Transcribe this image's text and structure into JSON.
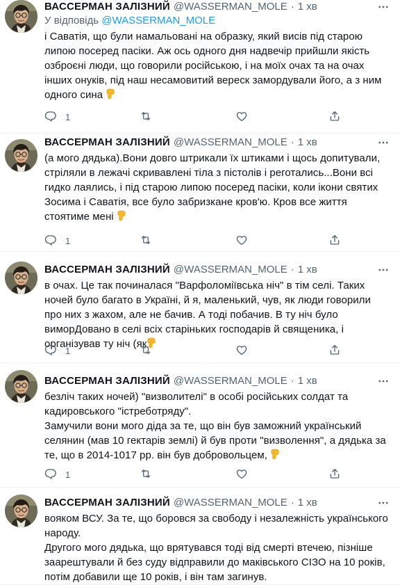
{
  "author": {
    "name": "ВАССЕРМАН ЗАЛІЗНИЙ",
    "handle": "@WASSERMAN_MOLE",
    "separator": "·",
    "time": "1 хв"
  },
  "reply_to": {
    "prefix": "У відповідь",
    "mention": "@WASSERMAN_MOLE"
  },
  "icons": {
    "reply": "reply-icon",
    "retweet": "retweet-icon",
    "like": "heart-icon",
    "share": "share-icon",
    "more": "more-icon",
    "finger": "backhand-index-pointing-down-emoji"
  },
  "colors": {
    "accent": "#1d9bf0",
    "muted": "#536471",
    "emoji": "#f4b400"
  },
  "tweets": [
    {
      "text": "і Саватія, що були намальовані на образку, який висів під старою липою посеред пасіки. Аж ось одного дня надвечір прийшли якість озброєні люди, що говорили російською, і на моїх очах та на очах інших онуків, під наш несамовитий вереск замордували його, а з ним одного сина ",
      "reply_count": "1"
    },
    {
      "text": "(а мого дядька).Вони довго штрикали їх штиками і щось допитували, стріляли в лежачі скривавлені тіла з пістолів і реготались...Вони всі гидко лаялись, і під старою липою посеред пасіки, коли ікони святих Зосима і Саватія, все було забризкане кров'ю. Кров все життя стоятиме мені ",
      "reply_count": "1"
    },
    {
      "text": "в очах. Це так починалася \"Варфоломіївська ніч\" в тім селі. Таких ночей було багато в Україні, й я, маленький, чув, як люди говорили про них з жахом, але не бачив. А тоді побачив. В ту ніч було виморДовано в селі всіх старіньких господарів й священика, і організував ту ніч (як",
      "reply_count": "1"
    },
    {
      "text": "безліч таких ночей) \"визволителі\" в особі російських солдат та кадировського \"істреботряду\".\nЗамучили вони мого діда за те, що він був заможний український селянин (мав 10 гектарів  землі) й був проти \"визволення\", а дядька за те, що    в 2014-1017 рр. він був добровольцем, ",
      "reply_count": "1"
    },
    {
      "text": "вояком ВСУ. За те, що боровся за свободу і незалежність українського народу.\nДругого мого дядька, що врятувався тоді від смерті втечею, пізніше заарештували й без суду відправили до маківського СІЗО на 10 років, потім добавили ще 10 років, і він там загинув.",
      "reply_count": ""
    }
  ]
}
